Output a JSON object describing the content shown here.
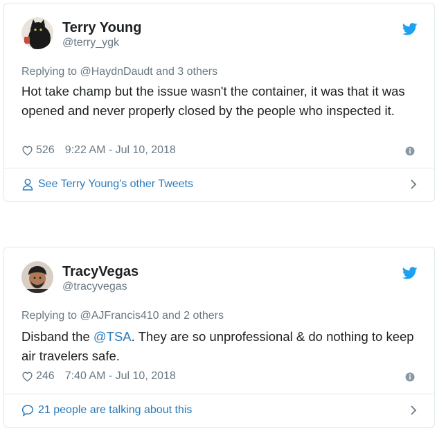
{
  "tweets": [
    {
      "name": "Terry Young",
      "handle": "@terry_ygk",
      "reply": {
        "prefix": "Replying to",
        "mention": "@HaydnDaudt",
        "suffix": "and 3 others"
      },
      "text": "Hot take champ but the issue wasn't the container, it was that it was opened and never properly closed by the people who inspected it.",
      "likes": "526",
      "timestamp": "9:22 AM - Jul 10, 2018",
      "footer": "See Terry Young's other Tweets"
    },
    {
      "name": "TracyVegas",
      "handle": "@tracyvegas",
      "reply": {
        "prefix": "Replying to",
        "mention": "@AJFrancis410",
        "suffix": "and 2 others"
      },
      "text_before": "Disband the ",
      "text_mention": "@TSA",
      "text_after": ". They are so unprofessional & do nothing to keep air travelers safe.",
      "likes": "246",
      "timestamp": "7:40 AM - Jul 10, 2018",
      "footer": "21 people are talking about this"
    }
  ],
  "colors": {
    "accent": "#1da1f2",
    "link": "#2b7bb9",
    "muted": "#697882",
    "border": "#e1e8ed"
  },
  "icons": [
    "twitter-bird-icon",
    "heart-icon",
    "info-icon",
    "person-icon",
    "speech-bubble-icon",
    "chevron-right-icon"
  ]
}
